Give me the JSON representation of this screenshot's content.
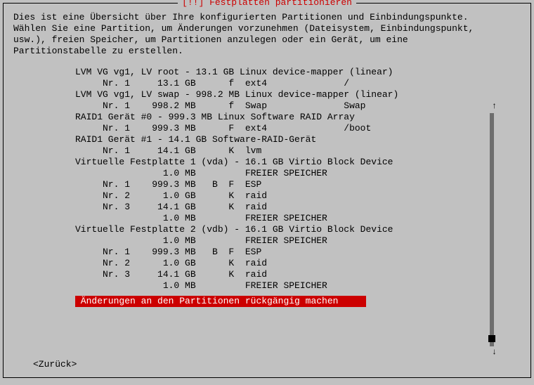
{
  "title": "[!!] Festplatten partitionieren",
  "intro": "Dies ist eine Übersicht über Ihre konfigurierten Partitionen und Einbindungspunkte.\nWählen Sie eine Partition, um Änderungen vorzunehmen (Dateisystem, Einbindungspunkt,\nusw.), freien Speicher, um Partitionen anzulegen oder ein Gerät, um eine\nPartitionstabelle zu erstellen.",
  "rows": [
    "LVM VG vg1, LV root - 13.1 GB Linux device-mapper (linear)",
    "     Nr. 1     13.1 GB      f  ext4              /",
    "LVM VG vg1, LV swap - 998.2 MB Linux device-mapper (linear)",
    "     Nr. 1    998.2 MB      f  Swap              Swap",
    "RAID1 Gerät #0 - 999.3 MB Linux Software RAID Array",
    "     Nr. 1    999.3 MB      F  ext4              /boot",
    "RAID1 Gerät #1 - 14.1 GB Software-RAID-Gerät",
    "     Nr. 1     14.1 GB      K  lvm",
    "Virtuelle Festplatte 1 (vda) - 16.1 GB Virtio Block Device",
    "                1.0 MB         FREIER SPEICHER",
    "     Nr. 1    999.3 MB   B  F  ESP",
    "     Nr. 2      1.0 GB      K  raid",
    "     Nr. 3     14.1 GB      K  raid",
    "                1.0 MB         FREIER SPEICHER",
    "Virtuelle Festplatte 2 (vdb) - 16.1 GB Virtio Block Device",
    "                1.0 MB         FREIER SPEICHER",
    "     Nr. 1    999.3 MB   B  F  ESP",
    "     Nr. 2      1.0 GB      K  raid",
    "     Nr. 3     14.1 GB      K  raid",
    "                1.0 MB         FREIER SPEICHER"
  ],
  "selected": " Änderungen an den Partitionen rückgängig machen",
  "back": "<Zurück>",
  "arrows": {
    "up": "↑",
    "down": "↓"
  }
}
